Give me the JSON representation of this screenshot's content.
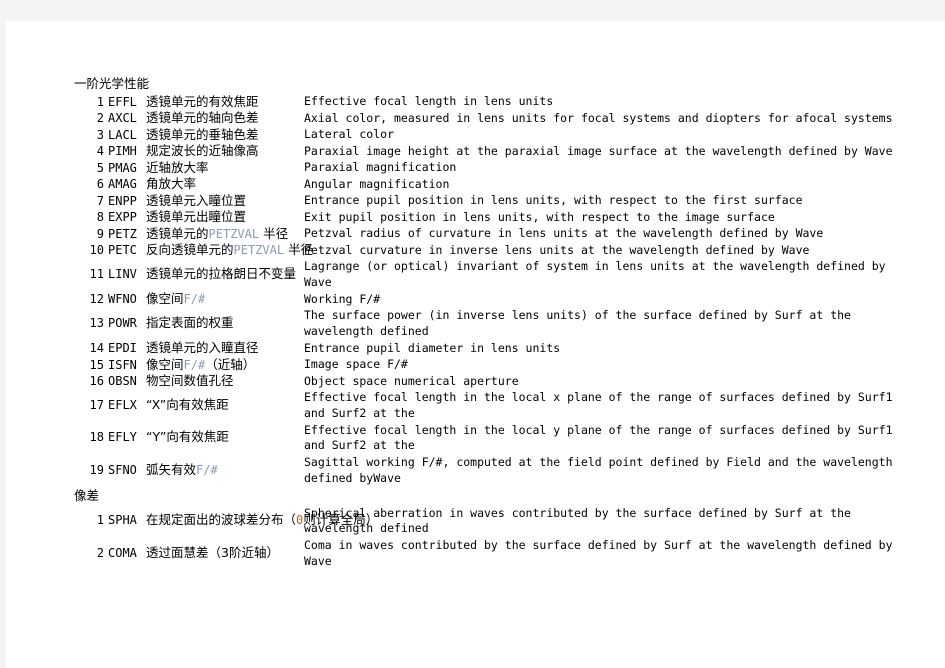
{
  "document": {
    "background_color": "#ffffff",
    "page_margin_color": "#f4f4f4",
    "highlight_blue": "#8a9bb4",
    "highlight_orange": "#b5651d",
    "sections": [
      {
        "title": "一阶光学性能",
        "rows": [
          {
            "index": "1",
            "mnemonic": "EFFL",
            "chinese": "透镜单元的有效焦距",
            "english": [
              "Effective focal length in lens units"
            ]
          },
          {
            "index": "2",
            "mnemonic": "AXCL",
            "chinese": "透镜单元的轴向色差",
            "english": [
              "Axial color, measured in lens units for focal systems and diopters for afocal systems"
            ]
          },
          {
            "index": "3",
            "mnemonic": "LACL",
            "chinese": "透镜单元的垂轴色差",
            "english": [
              "Lateral color"
            ]
          },
          {
            "index": "4",
            "mnemonic": "PIMH",
            "chinese": "规定波长的近轴像高",
            "english": [
              "Paraxial image height at the paraxial image surface at the wavelength defined by Wave"
            ]
          },
          {
            "index": "5",
            "mnemonic": "PMAG",
            "chinese": "近轴放大率",
            "english": [
              "Paraxial magnification"
            ]
          },
          {
            "index": "6",
            "mnemonic": "AMAG",
            "chinese": "角放大率",
            "english": [
              "Angular magnification"
            ]
          },
          {
            "index": "7",
            "mnemonic": "ENPP",
            "chinese": "透镜单元入瞳位置",
            "english": [
              "Entrance pupil position in lens units, with respect to the first surface"
            ]
          },
          {
            "index": "8",
            "mnemonic": "EXPP",
            "chinese": "透镜单元出瞳位置",
            "english": [
              "Exit pupil position in lens units, with respect to the image surface"
            ]
          },
          {
            "index": "9",
            "mnemonic": "PETZ",
            "chinese_pre": "透镜单元的",
            "chinese_hl": "PETZVAL",
            "chinese_post": " 半径",
            "english": [
              "Petzval radius of curvature in lens units at the wavelength defined by Wave"
            ]
          },
          {
            "index": "10",
            "mnemonic": "PETC",
            "chinese_pre": "反向透镜单元的",
            "chinese_hl": "PETZVAL",
            "chinese_post": " 半径",
            "english": [
              "Petzval curvature in inverse lens units at the wavelength defined by Wave"
            ]
          },
          {
            "index": "11",
            "mnemonic": "LINV",
            "chinese": "透镜单元的拉格朗日不变量",
            "english": [
              "Lagrange (or optical) invariant of system in lens units at the wavelength defined by",
              "Wave"
            ]
          },
          {
            "index": "12",
            "mnemonic": "WFNO",
            "chinese_pre": "像空间",
            "chinese_hl": "F/#",
            "chinese_post": "",
            "english": [
              "Working F/#"
            ]
          },
          {
            "index": "13",
            "mnemonic": "POWR",
            "chinese": "指定表面的权重",
            "english": [
              "The surface power (in inverse lens units) of the surface defined by Surf at the",
              "wavelength defined"
            ]
          },
          {
            "index": "14",
            "mnemonic": "EPDI",
            "chinese": "透镜单元的入瞳直径",
            "english": [
              "Entrance pupil diameter in lens units"
            ]
          },
          {
            "index": "15",
            "mnemonic": "ISFN",
            "chinese_pre": "像空间",
            "chinese_hl": "F/#",
            "chinese_post": "（近轴）",
            "english": [
              "Image space F/#"
            ]
          },
          {
            "index": "16",
            "mnemonic": "OBSN",
            "chinese": "物空间数值孔径",
            "english": [
              "Object space numerical aperture"
            ]
          },
          {
            "index": "17",
            "mnemonic": "EFLX",
            "chinese": "“X”向有效焦距",
            "english": [
              "Effective focal length in the local x plane of the range of surfaces defined by Surf1",
              "and Surf2 at the"
            ]
          },
          {
            "index": "18",
            "mnemonic": "EFLY",
            "chinese": "“Y”向有效焦距",
            "english": [
              "Effective focal length in the local y plane of the range of surfaces defined by Surf1",
              "and Surf2 at the"
            ]
          },
          {
            "index": "19",
            "mnemonic": "SFNO",
            "chinese_pre": "弧矢有效",
            "chinese_hl": "F/#",
            "chinese_post": "",
            "english": [
              "Sagittal working F/#, computed at the field point defined by Field and the wavelength",
              "defined byWave"
            ]
          }
        ]
      },
      {
        "title": "像差",
        "rows": [
          {
            "index": "1",
            "mnemonic": "SPHA",
            "chinese_pre": "在规定面出的波球差分布（",
            "chinese_hl_orange": "0",
            "chinese_post": "则计算全局）",
            "english": [
              "Spherical aberration in waves contributed by the surface defined by Surf at the",
              "wavelength defined"
            ]
          },
          {
            "index": "2",
            "mnemonic": "COMA",
            "chinese": "透过面慧差（3阶近轴）",
            "english": [
              "Coma in waves contributed by the surface defined by Surf at the wavelength defined by",
              "Wave"
            ]
          }
        ]
      }
    ]
  }
}
